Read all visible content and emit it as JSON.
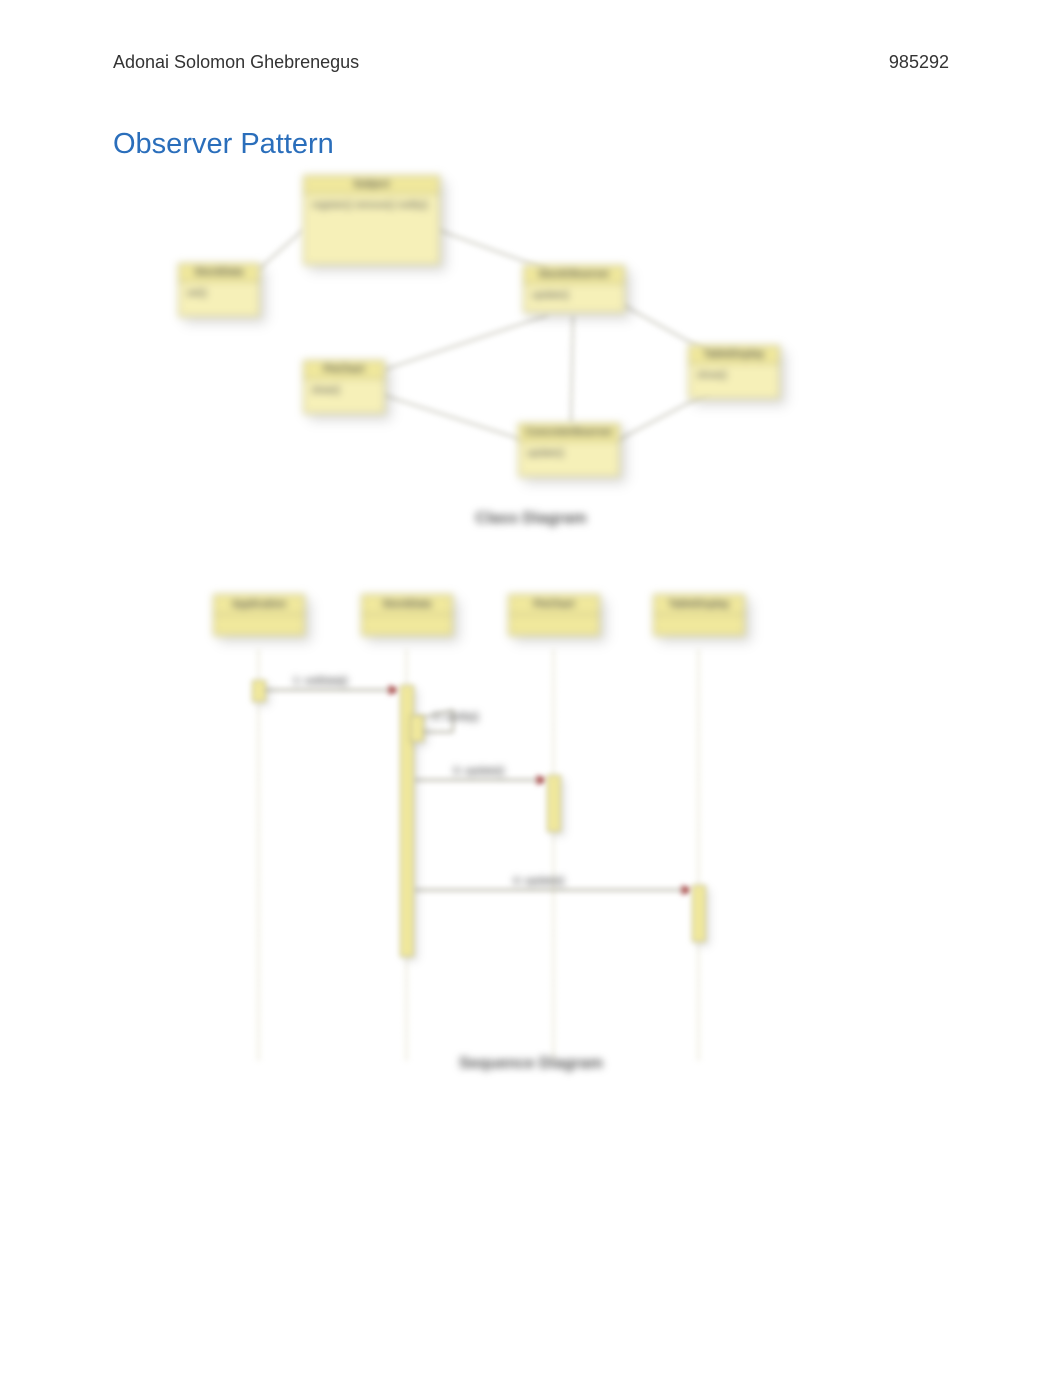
{
  "header": {
    "author": "Adonai Solomon Ghebrenegus",
    "id": "985292"
  },
  "title": "Observer Pattern",
  "classDiagram": {
    "caption": "Class Diagram",
    "boxes": {
      "subject": {
        "name": "Subject",
        "body": "register()\nremove()\nnotify()"
      },
      "concreteSubject": {
        "name": "StockData",
        "body": "set()"
      },
      "stockObserver": {
        "name": "StockObserver",
        "body": "update()"
      },
      "pieChart": {
        "name": "PieChart",
        "body": "draw()"
      },
      "concreteObserver": {
        "name": "ConcreteObserver",
        "body": "update()"
      },
      "tableDisplay": {
        "name": "TableDisplay",
        "body": "show()"
      }
    }
  },
  "sequenceDiagram": {
    "caption": "Sequence Diagram",
    "participants": [
      "Application",
      "StockData",
      "PieChart",
      "TableDisplay"
    ],
    "messages": {
      "m1": "1: setData()",
      "m2": "2: notify()",
      "m3": "3: update()",
      "m4": "4: update()"
    }
  }
}
